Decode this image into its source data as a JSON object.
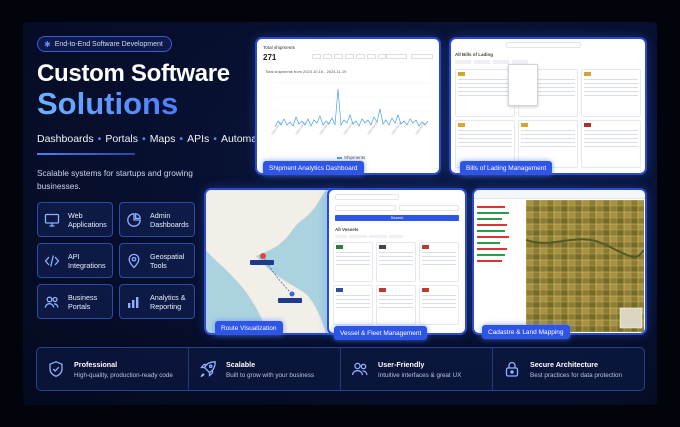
{
  "badge": "End-to-End Software Development",
  "title_line1": "Custom Software",
  "title_line2": "Solutions",
  "tags": [
    "Dashboards",
    "Portals",
    "Maps",
    "APIs",
    "Automation"
  ],
  "subtitle": "Scalable systems for startups and growing businesses.",
  "services": [
    {
      "label_1": "Web",
      "label_2": "Applications",
      "icon": "monitor-icon"
    },
    {
      "label_1": "Admin",
      "label_2": "Dashboards",
      "icon": "pie-chart-icon"
    },
    {
      "label_1": "API",
      "label_2": "Integrations",
      "icon": "code-icon"
    },
    {
      "label_1": "Geospatial",
      "label_2": "Tools",
      "icon": "map-pin-icon"
    },
    {
      "label_1": "Business",
      "label_2": "Portals",
      "icon": "users-icon"
    },
    {
      "label_1": "Analytics &",
      "label_2": "Reporting",
      "icon": "bar-chart-icon"
    }
  ],
  "panels": {
    "shipment": {
      "caption": "Shipment Analytics Dashboard",
      "heading": "Total shipments",
      "count": "271",
      "chart_title": "Total shipments from 2024.10.16 - 2024.11.19",
      "legend": "Shipments"
    },
    "bills": {
      "caption": "Bills of Lading Management",
      "heading": "All Bills of Lading"
    },
    "route": {
      "caption": "Route Visualization"
    },
    "vessel": {
      "caption": "Vessel & Fleet Management",
      "heading": "All Vessels",
      "search_button": "Search"
    },
    "cadastre": {
      "caption": "Cadastre & Land Mapping"
    }
  },
  "features": [
    {
      "title": "Professional",
      "desc": "High-quality, production-ready code",
      "icon": "shield-check-icon"
    },
    {
      "title": "Scalable",
      "desc": "Built to grow with your business",
      "icon": "rocket-icon"
    },
    {
      "title": "User-Friendly",
      "desc": "Intuitive interfaces & great UX",
      "icon": "users-icon"
    },
    {
      "title": "Secure Architecture",
      "desc": "Best practices for data protection",
      "icon": "lock-icon"
    }
  ]
}
